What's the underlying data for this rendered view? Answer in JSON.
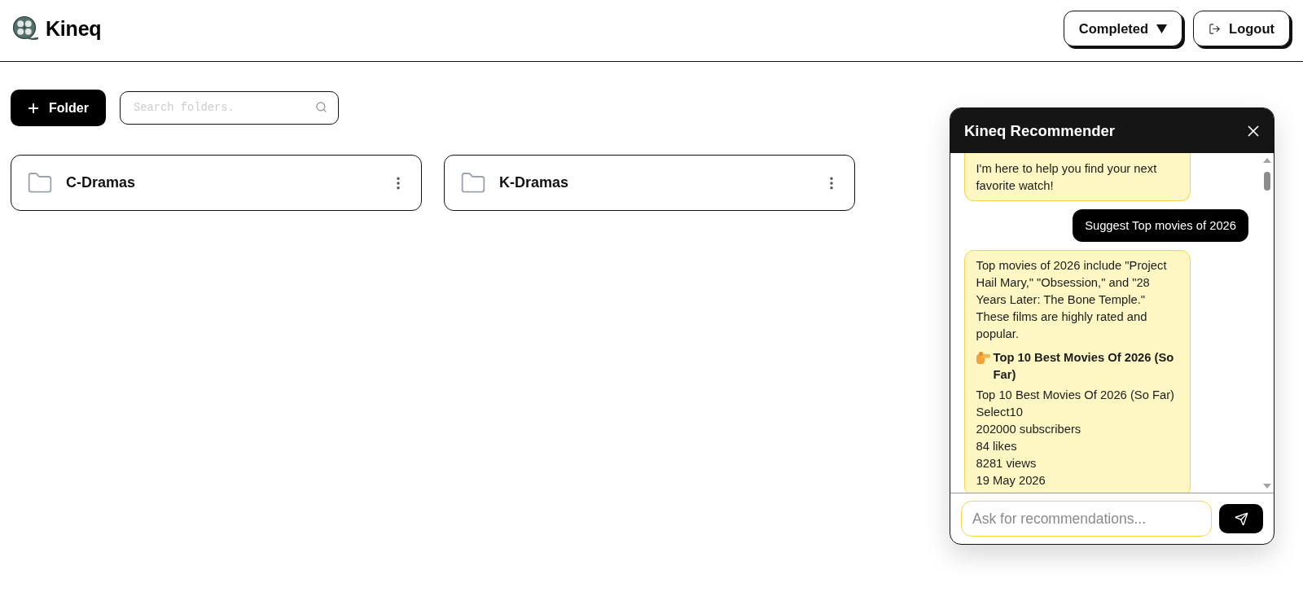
{
  "header": {
    "logo": "Kineq",
    "status_menu": {
      "label": "Completed"
    },
    "logout": {
      "label": "Logout"
    }
  },
  "toolbar": {
    "add_button": {
      "label": "Folder"
    },
    "search": {
      "placeholder": "Search folders."
    }
  },
  "folders": [
    {
      "name": "C-Dramas"
    },
    {
      "name": "K-Dramas"
    }
  ],
  "chat": {
    "title": "Kineq Recommender",
    "messages": [
      {
        "kind": "bot",
        "blocks": [
          {
            "kind": "text",
            "text": "I'm here to help you find your next favorite watch!"
          }
        ]
      },
      {
        "kind": "user",
        "text": "Suggest Top movies of 2026"
      },
      {
        "kind": "bot",
        "blocks": [
          {
            "kind": "text",
            "text": "Top movies of 2026 include \"Project Hail Mary,\" \"Obsession,\" and \"28 Years Later: The Bone Temple.\" These films are highly rated and popular."
          },
          {
            "kind": "video_title",
            "text": "Top 10 Best Movies Of 2026 (So Far)"
          },
          {
            "kind": "lines",
            "lines": [
              "Top 10 Best Movies Of 2026 (So Far)",
              "Select10",
              "202000 subscribers",
              "84 likes",
              "8281 views",
              "19 May 2026"
            ]
          }
        ]
      }
    ],
    "input": {
      "placeholder": "Ask for recommendations..."
    }
  }
}
